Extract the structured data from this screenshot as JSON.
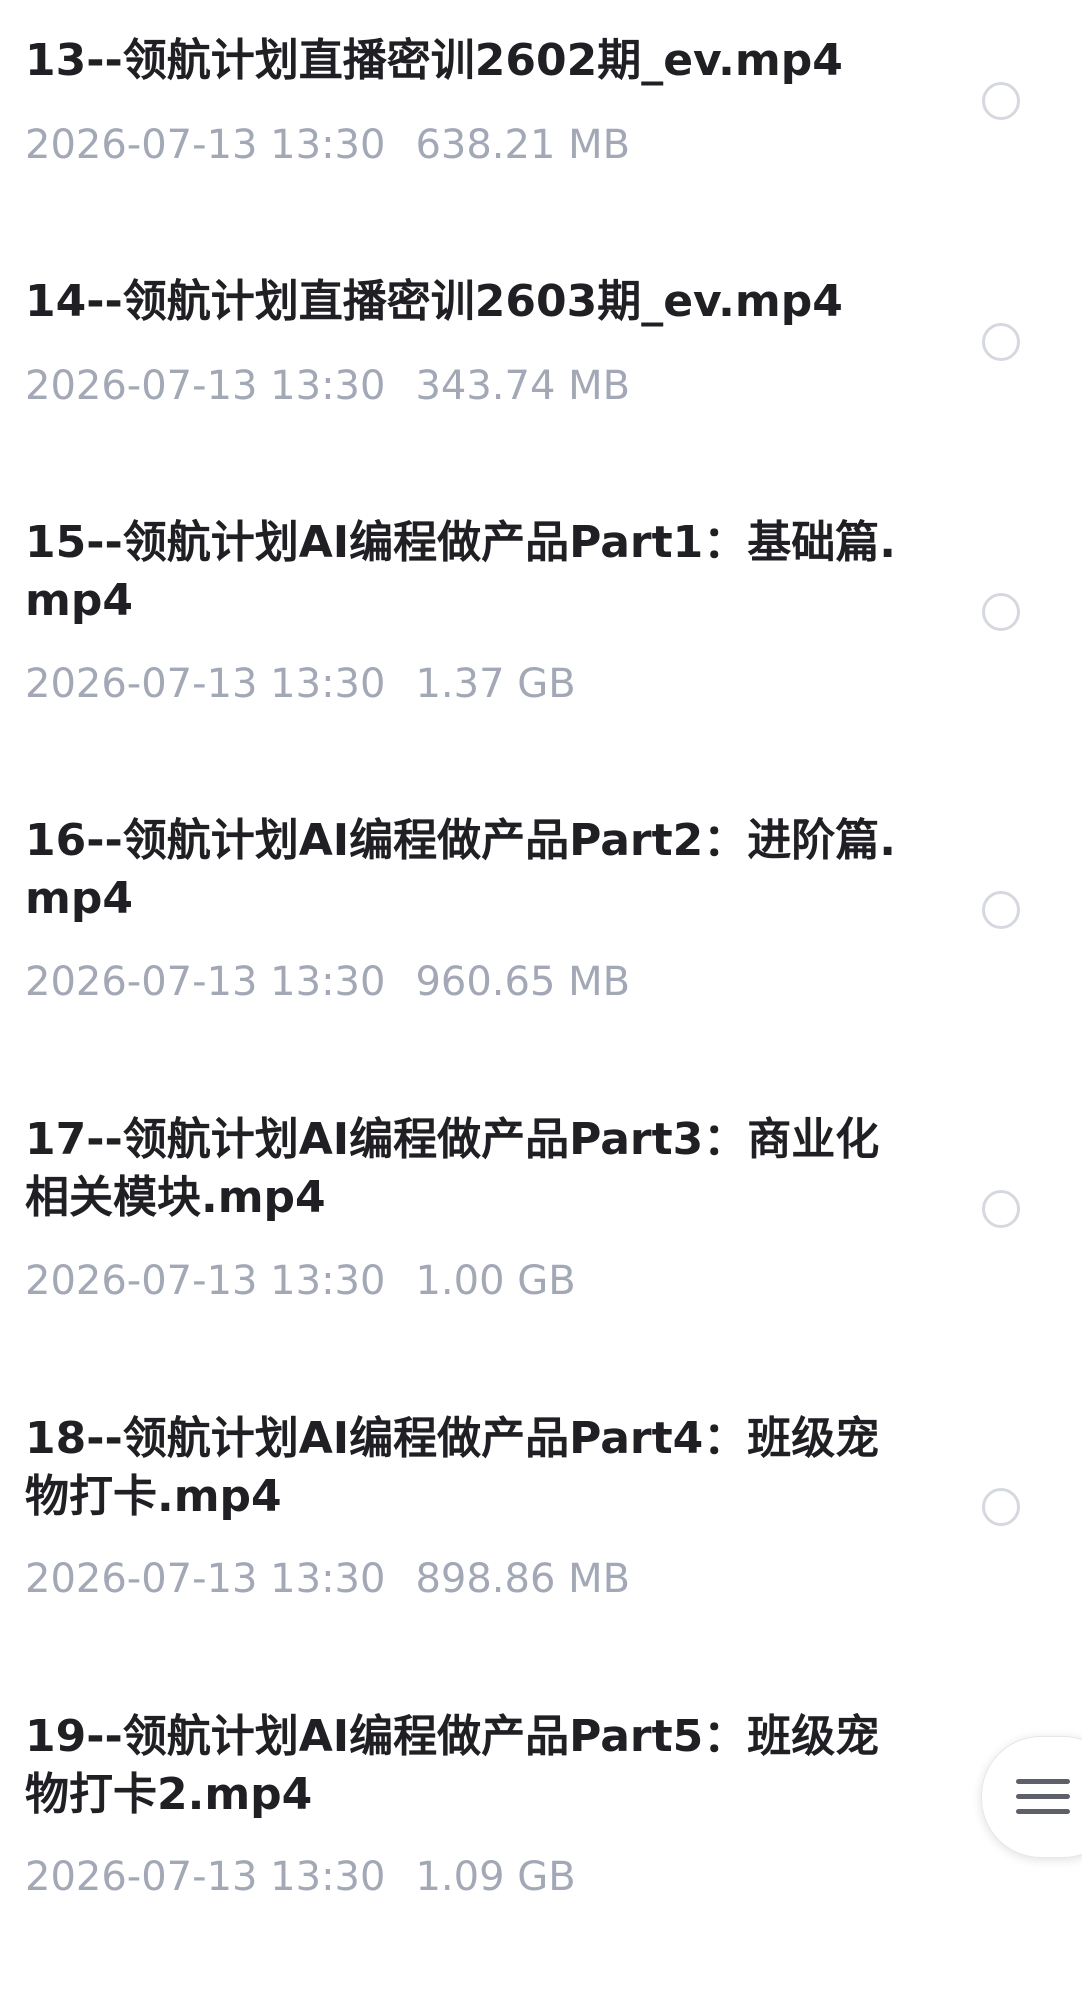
{
  "files": [
    {
      "name": "13--领航计划直播密训2602期_ev.mp4",
      "date": "2026-07-13 13:30",
      "size": "638.21 MB"
    },
    {
      "name": "14--领航计划直播密训2603期_ev.mp4",
      "date": "2026-07-13 13:30",
      "size": "343.74 MB"
    },
    {
      "name": "15--领航计划AI编程做产品Part1：基础篇.mp4",
      "date": "2026-07-13 13:30",
      "size": "1.37 GB"
    },
    {
      "name": "16--领航计划AI编程做产品Part2：进阶篇.mp4",
      "date": "2026-07-13 13:30",
      "size": "960.65 MB"
    },
    {
      "name": "17--领航计划AI编程做产品Part3：商业化相关模块.mp4",
      "date": "2026-07-13 13:30",
      "size": "1.00 GB"
    },
    {
      "name": "18--领航计划AI编程做产品Part4：班级宠物打卡.mp4",
      "date": "2026-07-13 13:30",
      "size": "898.86 MB"
    },
    {
      "name": "19--领航计划AI编程做产品Part5：班级宠物打卡2.mp4",
      "date": "2026-07-13 13:30",
      "size": "1.09 GB"
    }
  ],
  "icons": {
    "select": "radio-circle-icon",
    "menu": "menu-icon"
  },
  "colors": {
    "title": "#1f1f24",
    "meta": "#a3a8b6",
    "radio_border": "#d5d8df"
  }
}
